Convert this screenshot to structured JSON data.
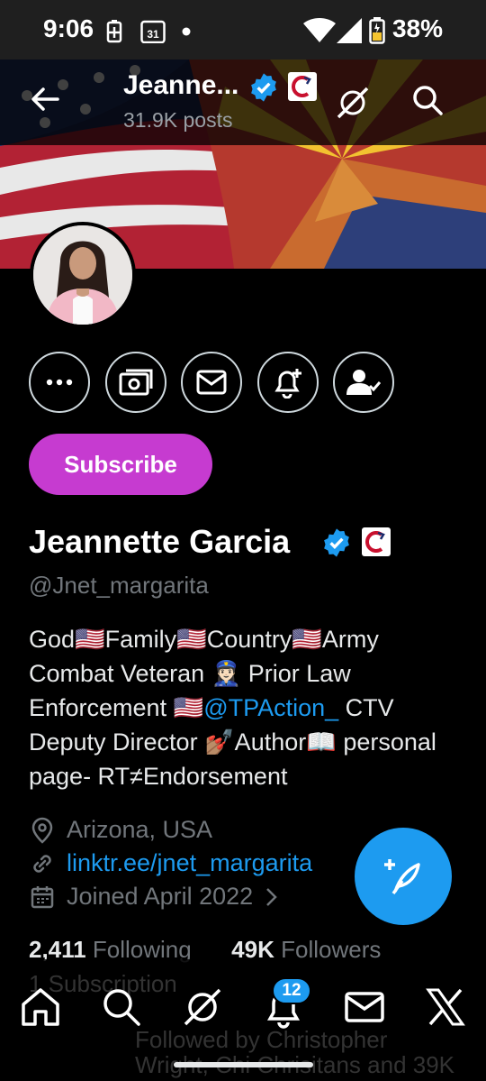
{
  "status_bar": {
    "time": "9:06",
    "battery": "38%",
    "calendar_day": "31"
  },
  "header": {
    "name": "Jeanne...",
    "posts": "31.9K posts"
  },
  "profile": {
    "name": "Jeannette Garcia",
    "handle": "@Jnet_margarita",
    "subscribe_label": "Subscribe",
    "bio": {
      "part1": "God🇺🇸Family🇺🇸Country🇺🇸Army Combat Veteran 👮🏻‍♀️ Prior Law Enforcement 🇺🇸",
      "mention": "@TPAction_",
      "part2": " CTV Deputy Director 💅🏽Author📖 personal page- RT≠Endorsement"
    },
    "location": "Arizona, USA",
    "website": "linktr.ee/jnet_margarita",
    "joined": "Joined April 2022",
    "following_count": "2,411",
    "following_label": "Following",
    "followers_count": "49K",
    "followers_label": "Followers",
    "subscriptions": "1 Subscription",
    "followed_by": "Followed by Christopher",
    "followed_by_2": "Wright, Chi Chrisitans and 39K"
  },
  "nav": {
    "notifications_badge": "12"
  },
  "colors": {
    "accent": "#1d9bf0",
    "subscribe": "#c63bd0",
    "background": "#000000"
  }
}
